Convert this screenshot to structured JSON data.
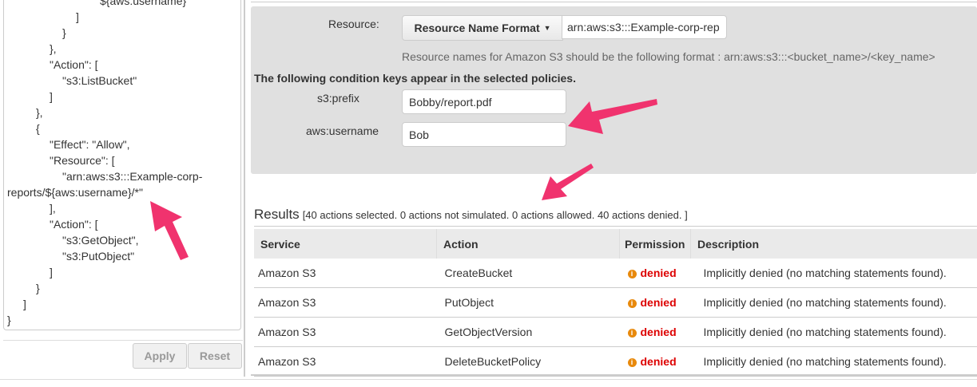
{
  "editor": {
    "lines": [
      {
        "pre": "",
        "sq": "",
        "text": "${aws:username}"
      },
      {
        "text": "]"
      },
      {
        "text": "}"
      },
      {
        "text": "},"
      },
      {
        "text": "\"Action\": ["
      },
      {
        "text": "\"s3:ListBucket\""
      },
      {
        "text": "]"
      },
      {
        "text": "},"
      },
      {
        "text": "{"
      },
      {
        "text": "\"Effect\": \"Allow\","
      },
      {
        "text": "\"Resource\": ["
      },
      {
        "text": "\"arn:aws:s3:::Example-corp-"
      },
      {
        "text": "reports/${aws:username}/*\""
      },
      {
        "text": "],"
      },
      {
        "text": "\"Action\": ["
      },
      {
        "text": "\"s3:GetObject\","
      },
      {
        "text": "\"s3:PutObject\""
      },
      {
        "text": "]"
      },
      {
        "text": "}"
      },
      {
        "text": "]"
      },
      {
        "text": "}"
      }
    ]
  },
  "buttons": {
    "apply": "Apply",
    "reset": "Reset"
  },
  "resource": {
    "label": "Resource:",
    "format_button": "Resource Name Format",
    "value": "arn:aws:s3:::Example-corp-rep",
    "hint": "Resource names for Amazon S3 should be the following format : arn:aws:s3:::<bucket_name>/<key_name>"
  },
  "conditions": {
    "heading": "The following condition keys appear in the selected policies.",
    "prefix_label": "s3:prefix",
    "prefix_value": "Bobby/report.pdf",
    "username_label": "aws:username",
    "username_value": "Bob"
  },
  "results": {
    "title": "Results",
    "summary": "[40 actions selected. 0 actions not simulated. 0 actions allowed. 40 actions denied. ]",
    "columns": [
      "Service",
      "Action",
      "Permission",
      "Description"
    ],
    "rows": [
      {
        "service": "Amazon S3",
        "action": "CreateBucket",
        "permission": "denied",
        "description": "Implicitly denied (no matching statements found)."
      },
      {
        "service": "Amazon S3",
        "action": "PutObject",
        "permission": "denied",
        "description": "Implicitly denied (no matching statements found)."
      },
      {
        "service": "Amazon S3",
        "action": "GetObjectVersion",
        "permission": "denied",
        "description": "Implicitly denied (no matching statements found)."
      },
      {
        "service": "Amazon S3",
        "action": "DeleteBucketPolicy",
        "permission": "denied",
        "description": "Implicitly denied (no matching statements found)."
      }
    ]
  },
  "colors": {
    "arrow": "#f0336e",
    "denied": "#dd0000",
    "info": "#e8890c"
  }
}
